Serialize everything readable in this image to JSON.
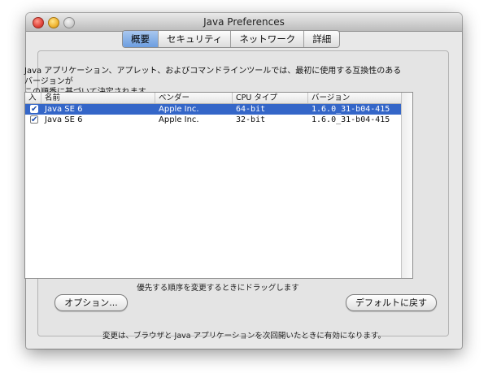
{
  "window": {
    "title": "Java Preferences"
  },
  "tabs": [
    {
      "label": "概要",
      "active": true
    },
    {
      "label": "セキュリティ",
      "active": false
    },
    {
      "label": "ネットワーク",
      "active": false
    },
    {
      "label": "詳細",
      "active": false
    }
  ],
  "description": {
    "line1": "Java アプリケーション、アプレット、およびコマンドラインツールでは、最初に使用する互換性のあるバージョンが",
    "line2": "この順番に基づいて決定されます。"
  },
  "table": {
    "headers": {
      "enabled": "入",
      "name": "名前",
      "vendor": "ベンダー",
      "cpu": "CPU タイプ",
      "version": "バージョン"
    },
    "rows": [
      {
        "checked": true,
        "name": "Java SE 6",
        "vendor": "Apple Inc.",
        "cpu": "64-bit",
        "version": "1.6.0_31-b04-415",
        "selected": true
      },
      {
        "checked": true,
        "name": "Java SE 6",
        "vendor": "Apple Inc.",
        "cpu": "32-bit",
        "version": "1.6.0_31-b04-415",
        "selected": false
      }
    ]
  },
  "hint": "優先する順序を変更するときにドラッグします",
  "buttons": {
    "options": "オプション...",
    "restore_defaults": "デフォルトに戻す"
  },
  "footer": "変更は、ブラウザと Java アプリケーションを次回開いたときに有効になります。",
  "colors": {
    "selection": "#3466c8",
    "active_tab": "#6c9ee0"
  }
}
